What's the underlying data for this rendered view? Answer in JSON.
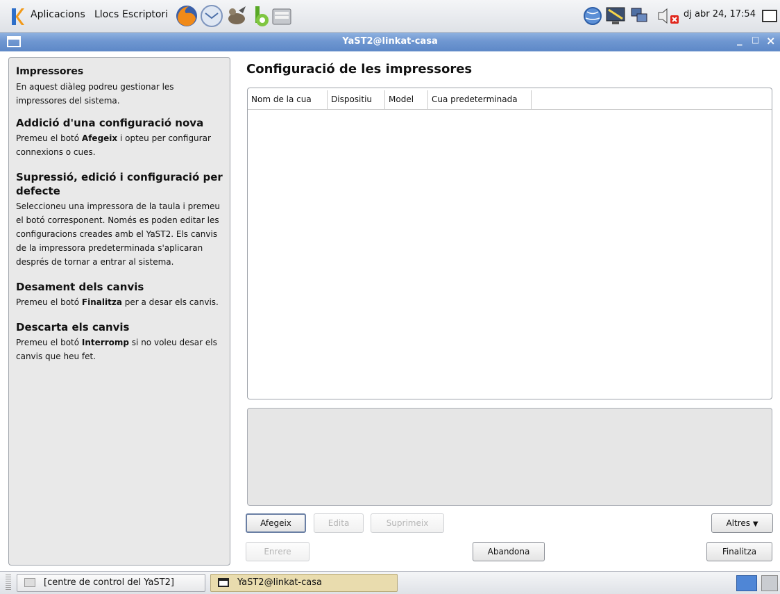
{
  "top_panel": {
    "menus": [
      "Aplicacions",
      "Llocs",
      "Escriptori"
    ],
    "clock": "dj abr 24, 17:54"
  },
  "window": {
    "title": "YaST2@linkat-casa",
    "controls": [
      "_",
      "□",
      "×"
    ]
  },
  "help": {
    "sections": [
      {
        "heading": "Impressores",
        "text": "En aquest diàleg podreu gestionar les impressores del sistema."
      },
      {
        "heading": "Addició d'una configuració nova",
        "text_before": "Premeu el botó ",
        "bold": "Afegeix",
        "text_after": " i opteu per configurar connexions o cues."
      },
      {
        "heading": "Supressió, edició i configuració per defecte",
        "text": "Seleccioneu una impressora de la taula i premeu el botó corresponent. Només es poden editar les configuracions creades amb el YaST2. Els canvis de la impressora predeterminada s'aplicaran després de tornar a entrar al sistema."
      },
      {
        "heading": "Desament dels canvis",
        "text_before": "Premeu el botó ",
        "bold": "Finalitza",
        "text_after": " per a desar els canvis."
      },
      {
        "heading": "Descarta els canvis",
        "text_before": "Premeu el botó ",
        "bold": "Interromp",
        "text_after": " si no voleu desar els canvis que heu fet."
      }
    ]
  },
  "main": {
    "title": "Configuració de les impressores",
    "columns": [
      "Nom de la cua",
      "Dispositiu",
      "Model",
      "Cua predeterminada"
    ],
    "buttons": {
      "add": "Afegeix",
      "edit": "Edita",
      "delete": "Suprimeix",
      "others": "Altres",
      "back": "Enrere",
      "abort": "Abandona",
      "finish": "Finalitza"
    }
  },
  "taskbar": {
    "tasks": [
      "[centre de control del YaST2]",
      "YaST2@linkat-casa"
    ]
  },
  "colors": {
    "titlebar": "#6f97d1",
    "help_bg": "#e9e9e9",
    "active_task": "#e9dcae"
  }
}
